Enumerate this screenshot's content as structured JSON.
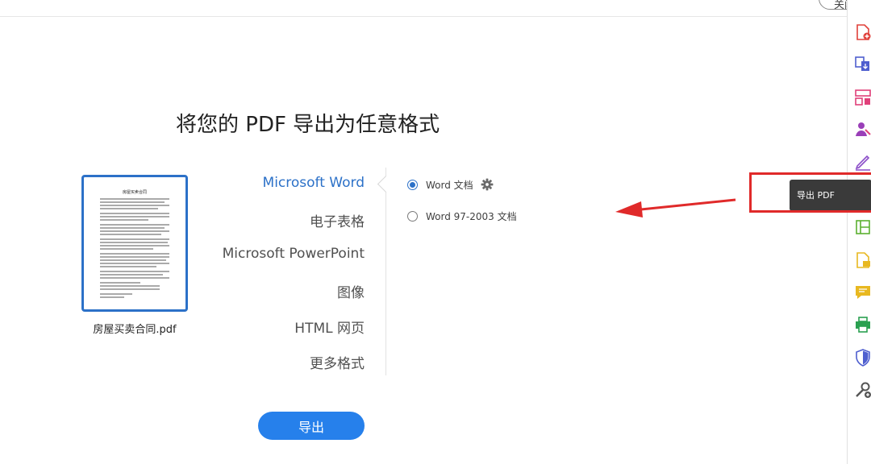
{
  "window": {
    "close_label": "关闭"
  },
  "main": {
    "title": "将您的 PDF 导出为任意格式",
    "file_name": "房屋买卖合同.pdf",
    "thumbnail_heading": "房屋买卖合同",
    "formats": [
      {
        "label": "Microsoft Word",
        "selected": true
      },
      {
        "label": "电子表格",
        "selected": false
      },
      {
        "label": "Microsoft PowerPoint",
        "selected": false
      },
      {
        "label": "图像",
        "selected": false
      },
      {
        "label": "HTML 网页",
        "selected": false
      },
      {
        "label": "更多格式",
        "selected": false
      }
    ],
    "options": [
      {
        "label": "Word 文档",
        "checked": true
      },
      {
        "label": "Word 97-2003 文档",
        "checked": false
      }
    ],
    "export_label": "导出"
  },
  "tooltip": {
    "text": "导出 PDF"
  },
  "colors": {
    "accent": "#2680eb",
    "selected_text": "#2c71c8",
    "annotation_red": "#e02a2a",
    "tooltip_bg": "#3a3a3a"
  },
  "rail_tools": [
    {
      "icon": "create-pdf-icon",
      "color": "#e0403a"
    },
    {
      "icon": "combine-files-icon",
      "color": "#4f5fcf"
    },
    {
      "icon": "organize-pages-icon",
      "color": "#e0407a"
    },
    {
      "icon": "request-signature-icon",
      "color": "#9a3fb8"
    },
    {
      "icon": "fill-sign-icon",
      "color": "#8a4cc8"
    },
    {
      "icon": "export-pdf-icon",
      "color": "#20a0a0"
    },
    {
      "icon": "edit-pdf-icon",
      "color": "#5cb030"
    },
    {
      "icon": "send-review-icon",
      "color": "#e8b820"
    },
    {
      "icon": "comment-icon",
      "color": "#e8b820"
    },
    {
      "icon": "print-production-icon",
      "color": "#2aa050"
    },
    {
      "icon": "protect-icon",
      "color": "#4f5fcf"
    },
    {
      "icon": "more-tools-icon",
      "color": "#555555"
    }
  ]
}
